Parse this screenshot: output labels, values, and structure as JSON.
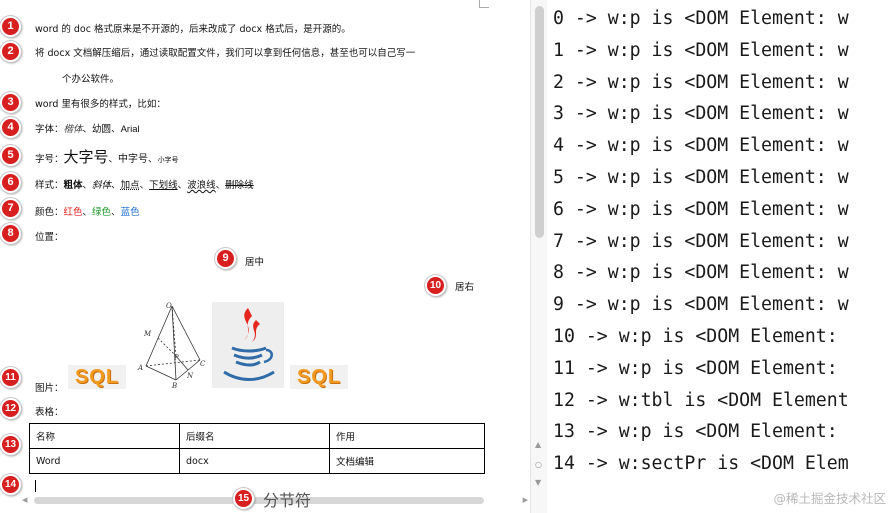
{
  "document": {
    "lines": [
      {
        "badge": "1",
        "text": "word 的 doc 格式原来是不开源的，后来改成了 docx 格式后，是开源的。"
      },
      {
        "badge": "2",
        "text": "将 docx 文档解压缩后，通过读取配置文件，我们可以拿到任何信息，甚至也可以自己写一"
      },
      {
        "badge": "",
        "text": "个办公软件。"
      },
      {
        "badge": "3",
        "text": "word 里有很多的样式，比如："
      }
    ],
    "font_line": {
      "badge": "4",
      "label": "字体：",
      "samples": [
        "楷体",
        "、",
        "幼圆",
        "、",
        "Arial"
      ]
    },
    "size_line": {
      "badge": "5",
      "label": "字号：",
      "samples": [
        "大字号",
        "、",
        "中字号",
        "、",
        "小字号"
      ]
    },
    "style_line": {
      "badge": "6",
      "label": "样式：",
      "samples": [
        "粗体",
        "、",
        "斜体",
        "、",
        "加点",
        "、",
        "下划线",
        "、",
        "波浪线",
        "、",
        "删除线"
      ]
    },
    "color_line": {
      "badge": "7",
      "label": "颜色：",
      "samples": [
        "红色",
        "、",
        "绿色",
        "、",
        "蓝色"
      ]
    },
    "position_line": {
      "badge": "8",
      "label": "位置："
    },
    "centered_line": {
      "badge": "9",
      "text": "居中"
    },
    "right_line": {
      "badge": "10",
      "text": "居右"
    },
    "image_line": {
      "badge": "11",
      "label": "图片：",
      "sql_logo_text": "SQL"
    },
    "pyramid_labels": {
      "top": "O",
      "left": "M",
      "mid": "P",
      "right": "C",
      "a": "A",
      "b": "B",
      "n": "N"
    },
    "table_line": {
      "badge": "12",
      "label": "表格："
    },
    "table": {
      "badge": "13",
      "rows": [
        [
          "名称",
          "后缀名",
          "作用"
        ],
        [
          "Word",
          "docx",
          "文档编辑"
        ]
      ]
    },
    "cursor_line": {
      "badge": "14"
    },
    "section_break": {
      "badge": "15",
      "text": "分节符"
    }
  },
  "console": {
    "lines": [
      "0 -> w:p is <DOM Element: w",
      "1 -> w:p is <DOM Element: w",
      "2 -> w:p is <DOM Element: w",
      "3 -> w:p is <DOM Element: w",
      "4 -> w:p is <DOM Element: w",
      "5 -> w:p is <DOM Element: w",
      "6 -> w:p is <DOM Element: w",
      "7 -> w:p is <DOM Element: w",
      "8 -> w:p is <DOM Element: w",
      "9 -> w:p is <DOM Element: w",
      "10 -> w:p is <DOM Element:",
      "11 -> w:p is <DOM Element:",
      "12 -> w:tbl is <DOM Element",
      "13 -> w:p is <DOM Element:",
      "14 -> w:sectPr is <DOM Elem"
    ],
    "watermark": "@稀土掘金技术社区"
  },
  "colors": {
    "badge": "#d81f1f",
    "red_sample": "#e02020",
    "green_sample": "#1a9a2a",
    "blue_sample": "#1e6fd1",
    "sql_orange": "#f29a1f"
  },
  "icons": [
    "scroll-left-arrow-icon",
    "scroll-right-arrow-icon",
    "scroll-up-arrow-icon",
    "scroll-down-arrow-icon",
    "java-logo-icon",
    "sql-logo-icon",
    "pyramid-diagram-icon"
  ]
}
